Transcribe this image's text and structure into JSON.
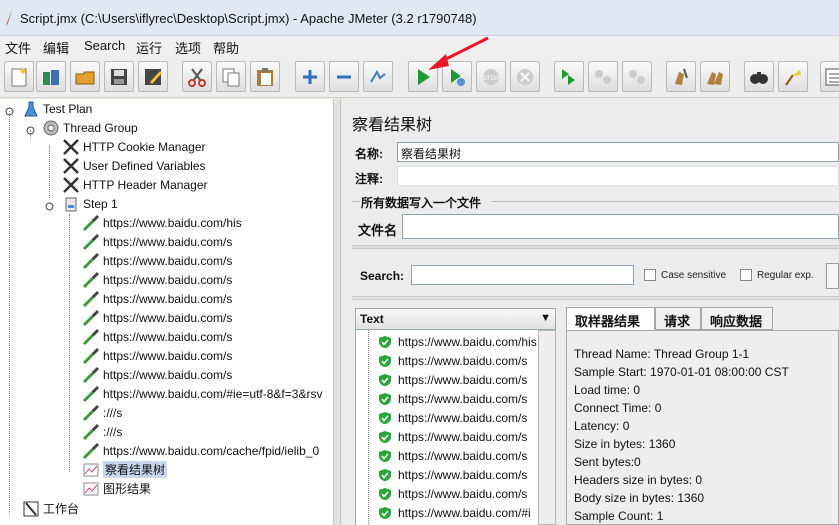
{
  "window": {
    "title": "Script.jmx (C:\\Users\\iflyrec\\Desktop\\Script.jmx) - Apache JMeter (3.2 r1790748)"
  },
  "menu": [
    "文件",
    "编辑",
    "Search",
    "运行",
    "选项",
    "帮助"
  ],
  "toolbar": [
    "new-icon",
    "templates-icon",
    "open-icon",
    "save-icon",
    "save-as-icon",
    "cut-icon",
    "copy-icon",
    "paste-icon",
    "expand-icon",
    "collapse-icon",
    "toggle-icon",
    "start-icon",
    "start-no-pause-icon",
    "stop-icon",
    "shutdown-icon",
    "remote-start-icon",
    "remote-stop-icon",
    "remote-shutdown-icon",
    "clear-icon",
    "clear-all-icon",
    "search-icon",
    "reset-search-icon",
    "function-helper-icon"
  ],
  "tree": {
    "test_plan": "Test Plan",
    "thread_group": "Thread Group",
    "cookie_manager": "HTTP Cookie Manager",
    "user_vars": "User Defined Variables",
    "header_manager": "HTTP Header Manager",
    "step": "Step 1",
    "samplers": [
      "https://www.baidu.com/his",
      "https://www.baidu.com/s",
      "https://www.baidu.com/s",
      "https://www.baidu.com/s",
      "https://www.baidu.com/s",
      "https://www.baidu.com/s",
      "https://www.baidu.com/s",
      "https://www.baidu.com/s",
      "https://www.baidu.com/s",
      "https://www.baidu.com/#ie=utf-8&f=3&rsv",
      ":///s",
      ":///s",
      "https://www.baidu.com/cache/fpid/ielib_0"
    ],
    "results_tree": "察看结果树",
    "graph_results": "图形结果",
    "workbench": "工作台"
  },
  "panel": {
    "title": "察看结果树",
    "name_label": "名称:",
    "name_value": "察看结果树",
    "comments_label": "注释:",
    "write_all_label": "所有数据写入一个文件",
    "filename_label": "文件名",
    "search_label": "Search:",
    "case_sensitive": "Case sensitive",
    "regular_exp": "Regular exp."
  },
  "results": {
    "header": "Text",
    "rows": [
      "https://www.baidu.com/his",
      "https://www.baidu.com/s",
      "https://www.baidu.com/s",
      "https://www.baidu.com/s",
      "https://www.baidu.com/s",
      "https://www.baidu.com/s",
      "https://www.baidu.com/s",
      "https://www.baidu.com/s",
      "https://www.baidu.com/s",
      "https://www.baidu.com/#i"
    ]
  },
  "tabs": [
    "取样器结果",
    "请求",
    "响应数据"
  ],
  "details": [
    "Thread Name: Thread Group 1-1",
    "Sample Start: 1970-01-01 08:00:00 CST",
    "Load time: 0",
    "Connect Time: 0",
    "Latency: 0",
    "Size in bytes: 1360",
    "Sent bytes:0",
    "Headers size in bytes: 0",
    "Body size in bytes: 1360",
    "Sample Count: 1"
  ],
  "colors": {
    "annotation_arrow": "#e8192c",
    "start_button": "#1e9a2e",
    "ok_icon": "#2aa53c"
  }
}
